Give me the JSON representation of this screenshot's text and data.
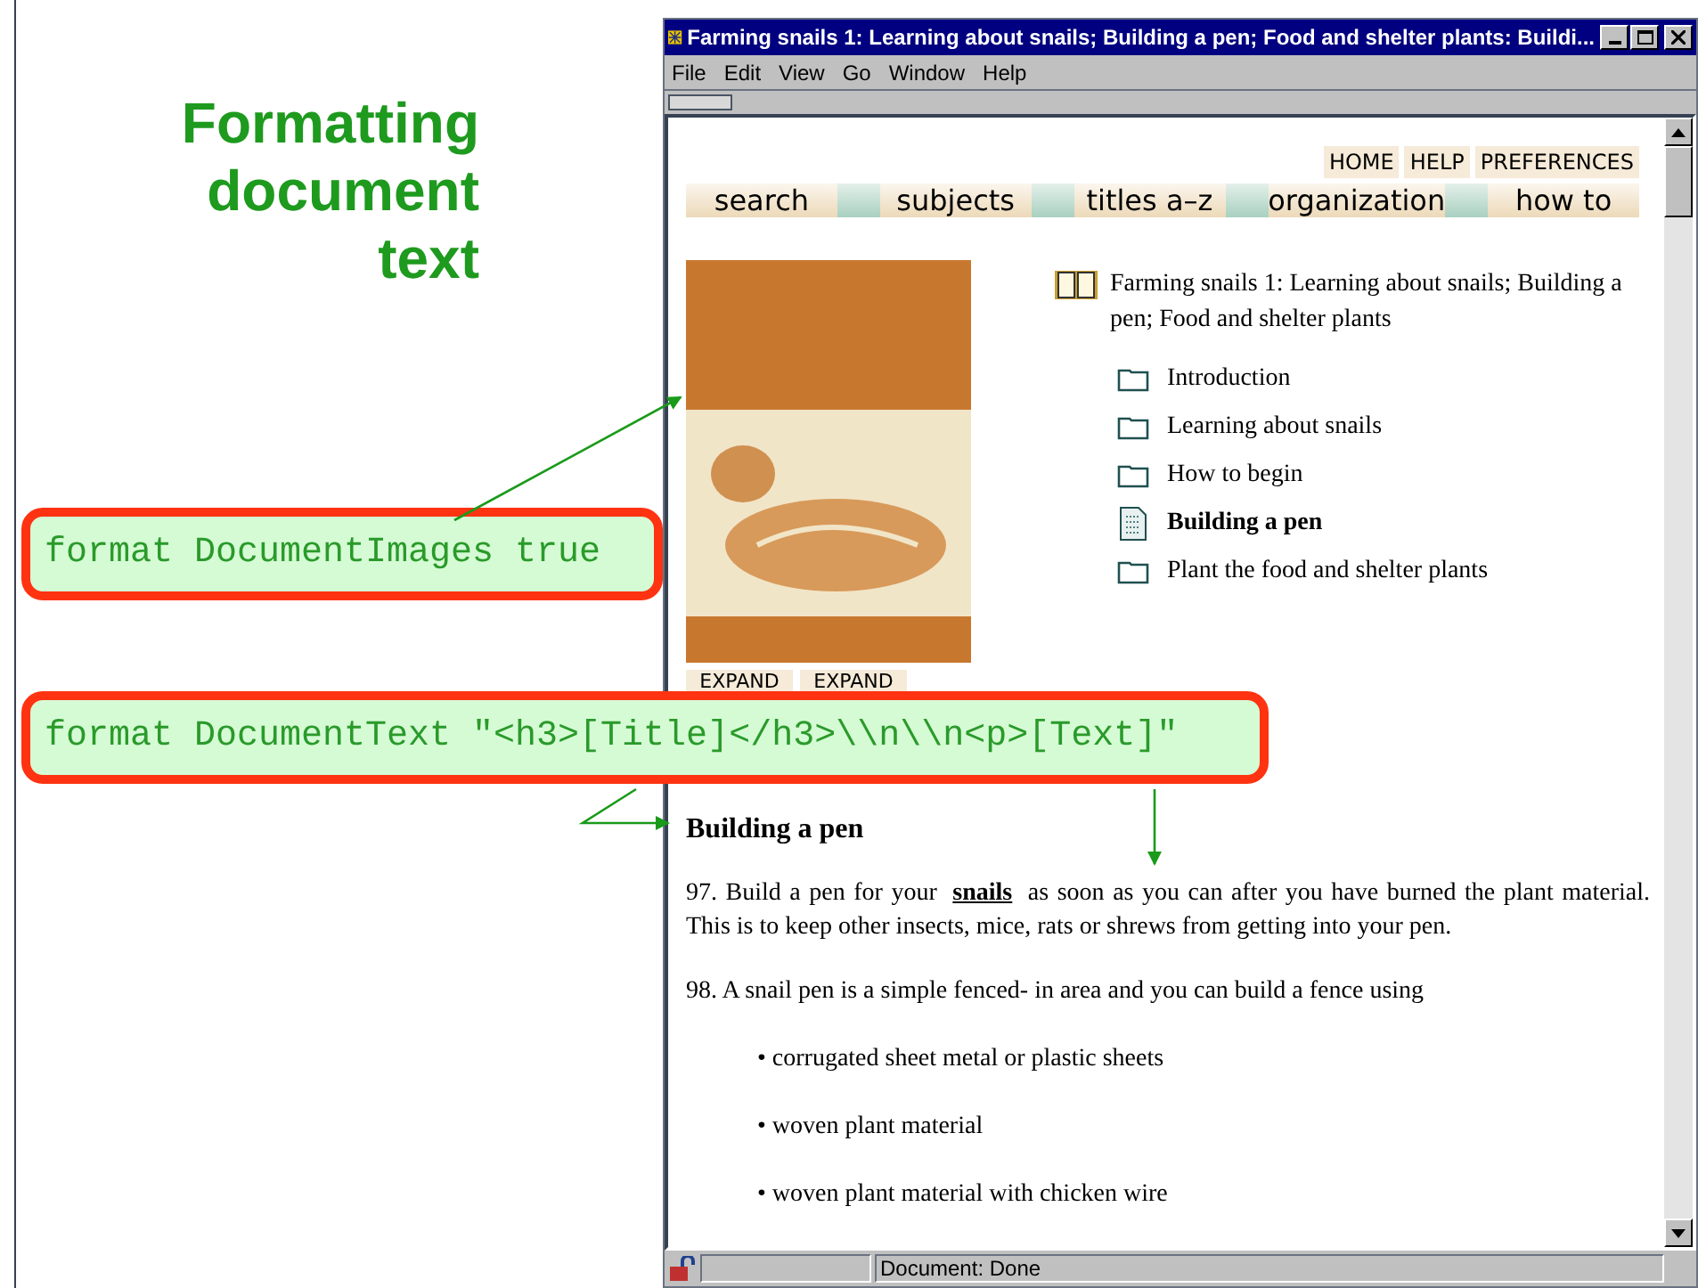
{
  "slide": {
    "title": "Formatting document text",
    "callouts": [
      {
        "code": "format DocumentImages true"
      },
      {
        "code": "format DocumentText \"<h3>[Title]</h3>\\\\n\\\\n<p>[Text]\""
      }
    ]
  },
  "browser": {
    "window_title": "Farming snails 1: Learning about snails; Building a pen; Food and shelter plants: Buildi...",
    "menu": [
      "File",
      "Edit",
      "View",
      "Go",
      "Window",
      "Help"
    ],
    "top_links": [
      "HOME",
      "HELP",
      "PREFERENCES"
    ],
    "tabs": [
      "search",
      "subjects",
      "titles a–z",
      "organization",
      "how to"
    ],
    "cover_buttons": [
      "EXPAND",
      "EXPAND"
    ],
    "toc": {
      "title": "Farming snails 1: Learning about snails; Building a pen; Food and shelter plants",
      "items": [
        {
          "label": "Introduction",
          "kind": "folder",
          "selected": false
        },
        {
          "label": "Learning about snails",
          "kind": "folder",
          "selected": false
        },
        {
          "label": "How to begin",
          "kind": "folder",
          "selected": false
        },
        {
          "label": "Building a pen",
          "kind": "page",
          "selected": true
        },
        {
          "label": "Plant the food and shelter plants",
          "kind": "folder",
          "selected": false
        }
      ]
    },
    "article": {
      "heading": "Building a pen",
      "paragraphs": [
        {
          "before": "97. Build a pen for your ",
          "link": "snails",
          "after": " as soon as you can after you have burned the plant material. This is to keep other insects, mice, rats or shrews from getting into your pen."
        },
        {
          "before": "98. A snail pen is a simple fenced- in area and you can build a fence using"
        }
      ],
      "bullets": [
        "• corrugated sheet metal or plastic sheets",
        "• woven plant material",
        "• woven plant material with chicken wire"
      ]
    },
    "status_bar": {
      "text": "Document: Done"
    }
  }
}
